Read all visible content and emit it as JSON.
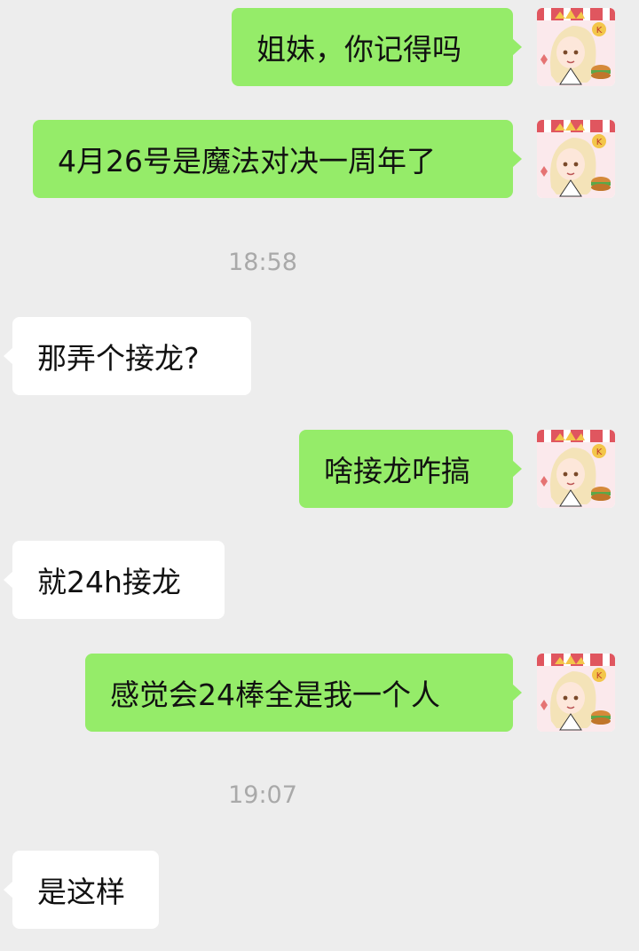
{
  "messages": [
    {
      "direction": "out",
      "text": "姐妹，你记得吗"
    },
    {
      "direction": "out",
      "text": "4月26号是魔法对决一周年了"
    },
    {
      "type": "time",
      "text": "18:58"
    },
    {
      "direction": "in",
      "text": "那弄个接龙?"
    },
    {
      "direction": "out",
      "text": "啥接龙咋搞"
    },
    {
      "direction": "in",
      "text": "就24h接龙"
    },
    {
      "direction": "out",
      "text": "感觉会24棒全是我一个人"
    },
    {
      "type": "time",
      "text": "19:07"
    },
    {
      "direction": "in",
      "text": "是这样"
    }
  ],
  "avatar": {
    "icon": "anime-character-avatar-icon",
    "badge_text": "K"
  },
  "colors": {
    "background": "#ededed",
    "outgoing_bubble": "#95ec69",
    "incoming_bubble": "#ffffff",
    "timestamp_text": "#a9a9a9"
  }
}
